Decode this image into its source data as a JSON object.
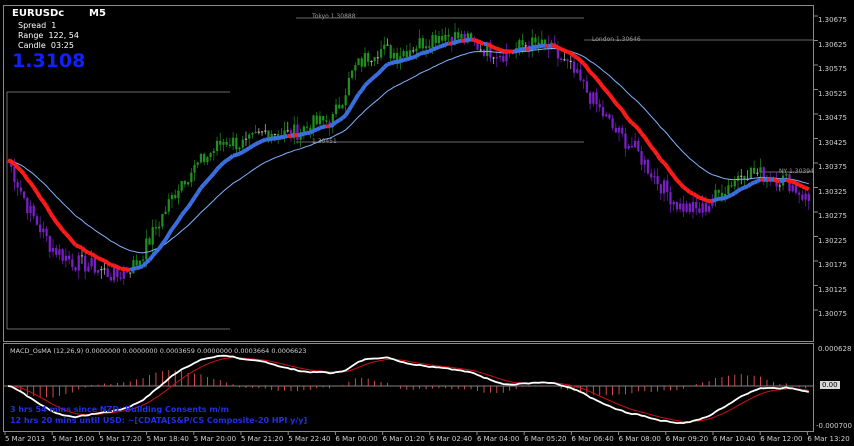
{
  "window": {
    "symbol": "EURUSDc",
    "timeframe": "M5"
  },
  "info_panel": {
    "spread_label": "Spread",
    "spread_value": "1",
    "range_label": "Range",
    "range_value": "122, 54",
    "candle_label": "Candle",
    "candle_value": "03:25",
    "bid": "1.3108"
  },
  "levels": {
    "tokyo": "Tokyo 1.30888",
    "asia_low": "1.30451",
    "london": "London 1.30646",
    "ny": "NY 1.30394"
  },
  "price_axis": [
    "1.30675",
    "1.30625",
    "1.30575",
    "1.30525",
    "1.30475",
    "1.30425",
    "1.30375",
    "1.30325",
    "1.30275",
    "1.30225",
    "1.30175",
    "1.30125",
    "1.30075"
  ],
  "macd": {
    "header": "MACD_OsMA (12,26,9) 0.0000000 0.0000000 0.0003659 0.0000000 0.0003664 0.0006623",
    "axis_top": "0.000628",
    "axis_mid": "0.00",
    "axis_bottom": "-0.000700"
  },
  "time_axis": [
    "5 Mar 2013",
    "5 Mar 16:00",
    "5 Mar 17:20",
    "5 Mar 18:40",
    "5 Mar 20:00",
    "5 Mar 21:20",
    "5 Mar 22:40",
    "6 Mar 00:00",
    "6 Mar 01:20",
    "6 Mar 02:40",
    "6 Mar 04:00",
    "6 Mar 05:20",
    "6 Mar 06:40",
    "6 Mar 08:00",
    "6 Mar 09:20",
    "6 Mar 10:40",
    "6 Mar 12:00",
    "6 Mar 13:20"
  ],
  "status": {
    "line1": "3 hrs 54 mins since NZD: Building Consents m/m",
    "line2": "12 hrs 20 mins until USD: ~[CDATA[S&P/CS Composite-20 HPI y/y]"
  },
  "chart_data": {
    "type": "line",
    "title": "",
    "ylim": [
      1.3005,
      1.307
    ],
    "x_labels_index": [
      0,
      1,
      2,
      3,
      4,
      5,
      6,
      7,
      8,
      9,
      10,
      11,
      12,
      13,
      14,
      15,
      16,
      17
    ],
    "series": [
      {
        "values_key": "close",
        "values": [
          1.304,
          1.303,
          1.3023,
          1.302,
          1.3019,
          1.3017,
          1.302,
          1.3028,
          1.3036,
          1.304,
          1.3044,
          1.3043,
          1.3046,
          1.3045,
          1.3047,
          1.3048,
          1.3058,
          1.3062,
          1.3061,
          1.3063,
          1.3065,
          1.3064,
          1.3062,
          1.3061,
          1.3063,
          1.3062,
          1.3058,
          1.3052,
          1.3046,
          1.3042,
          1.3036,
          1.3031,
          1.303,
          1.3034,
          1.3038,
          1.3037,
          1.3036,
          1.3032
        ]
      }
    ],
    "colors": {
      "up": "#1f8f1f",
      "down": "#7a1fc8",
      "doji": "#bfbfbf",
      "ma_fast_up": "#3a6fe0",
      "ma_fast_down": "#ff1a1a",
      "ma_slow": "#7fb2ff",
      "ma_slow_down": "#c01010",
      "macd_line": "#ffffff",
      "signal": "#cc1010",
      "hist": "#ff5a5a"
    }
  }
}
